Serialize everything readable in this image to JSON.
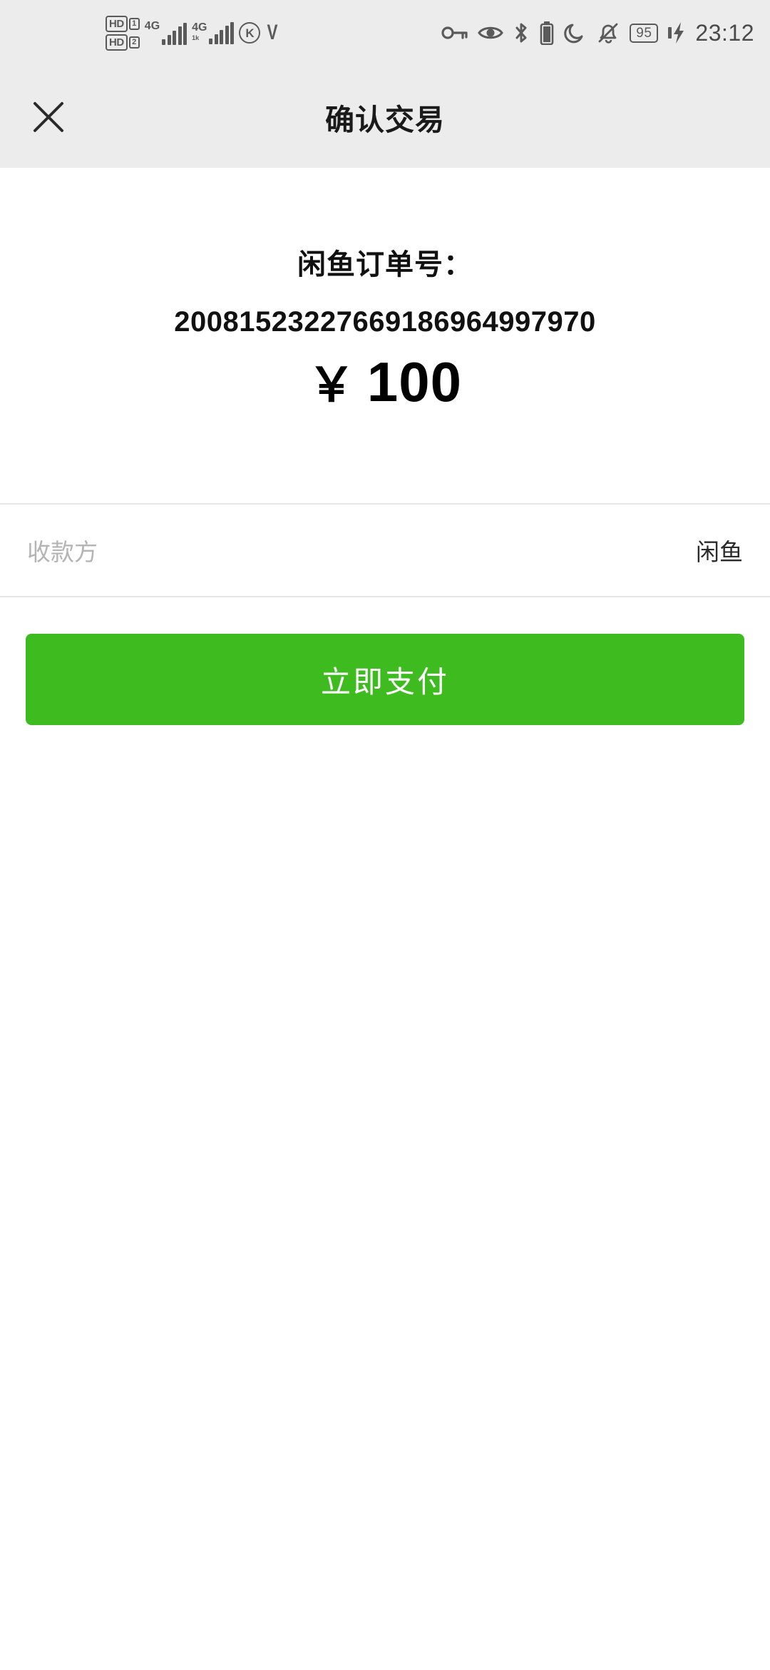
{
  "status_bar": {
    "volte_1": {
      "hd": "HD",
      "sim": "1"
    },
    "volte_2": {
      "hd": "HD",
      "sim": "2"
    },
    "signal_1": {
      "network": "4G",
      "sub": "",
      "bars": 5
    },
    "signal_2": {
      "network": "4G",
      "sub": "1k",
      "bars": 5
    },
    "kid_mode_letter": "K",
    "vpn_mark": "V",
    "icons": [
      "key-icon",
      "eye-icon",
      "bluetooth-icon",
      "battery-icon",
      "do-not-disturb-moon-icon",
      "bell-muted-icon",
      "charging-bolt-icon"
    ],
    "battery_percent": "95",
    "time": "23:12"
  },
  "header": {
    "close_label": "×",
    "title": "确认交易"
  },
  "order": {
    "label": "闲鱼订单号：",
    "number": "20081523227669186964997970",
    "currency_symbol": "￥",
    "amount": "100"
  },
  "payee": {
    "label": "收款方",
    "value": "闲鱼"
  },
  "actions": {
    "pay_label": "立即支付"
  },
  "colors": {
    "pay_button_green": "#3DBB1F",
    "status_bar_gray": "#ECECEC",
    "divider_gray": "#E6E6E6",
    "muted_text": "#B4B4B4"
  }
}
